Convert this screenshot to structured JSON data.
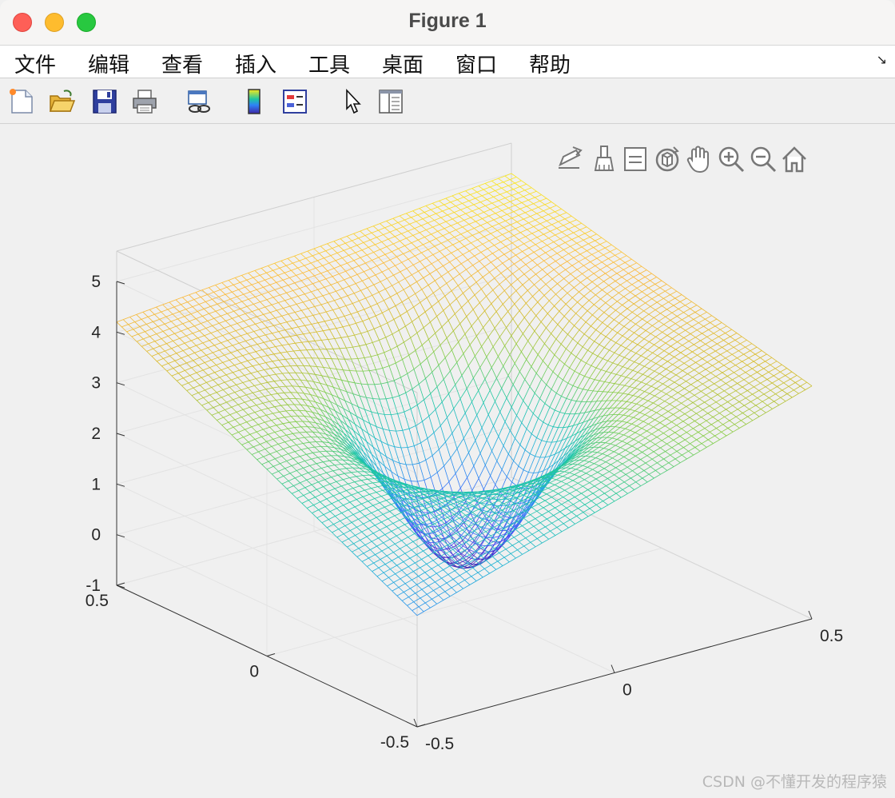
{
  "window": {
    "title": "Figure 1"
  },
  "menubar": {
    "items": [
      "文件",
      "编辑",
      "查看",
      "插入",
      "工具",
      "桌面",
      "窗口",
      "帮助"
    ],
    "corner_glyph": "↘"
  },
  "toolbar": {
    "buttons": [
      "new-figure-icon",
      "open-file-icon",
      "save-icon",
      "print-icon",
      "link-plot-icon",
      "insert-colorbar-icon",
      "insert-legend-icon",
      "edit-plot-arrow-icon",
      "property-inspector-icon"
    ]
  },
  "axes_toolbar": {
    "buttons": [
      "export-icon",
      "brush-icon",
      "datatip-icon",
      "rotate-3d-icon",
      "pan-hand-icon",
      "zoom-in-icon",
      "zoom-out-icon",
      "restore-view-home-icon"
    ]
  },
  "colors": {
    "colormap": [
      "#3e26a8",
      "#4743f3",
      "#2f82f6",
      "#1cb0d6",
      "#1ec7a3",
      "#7fcd49",
      "#d3bb2a",
      "#fbb839",
      "#f9e81b"
    ]
  },
  "chart_data": {
    "type": "surface",
    "style": "mesh",
    "colormap": "parula",
    "x": {
      "range": [
        -0.5,
        0.5
      ],
      "ticks": [
        -0.5,
        0,
        0.5
      ],
      "tick_labels": [
        "-0.5",
        "0",
        "0.5"
      ]
    },
    "y": {
      "range": [
        -0.5,
        0.5
      ],
      "ticks": [
        -0.5,
        0,
        0.5
      ],
      "tick_labels": [
        "-0.5",
        "0",
        "0.5"
      ]
    },
    "z": {
      "range": [
        -1,
        5
      ],
      "ticks": [
        -1,
        0,
        1,
        2,
        3,
        4,
        5
      ],
      "tick_labels": [
        "-1",
        "0",
        "1",
        "2",
        "3",
        "4",
        "5"
      ]
    },
    "grid": true,
    "title": "",
    "xlabel": "",
    "ylabel": "",
    "zlabel": "",
    "surface_values": {
      "corners": {
        "x-0.5_y-0.5": 1.2,
        "x0.5_y-0.5": 3.6,
        "x0.5_y0.5": 5.0,
        "x-0.5_y0.5": 4.2
      },
      "center_min": -0.3,
      "edge_midpoints": {
        "y-0.5": 1.4,
        "x0.5": 3.4,
        "y0.5": 4.3,
        "x-0.5": 3.0
      }
    }
  },
  "watermark": "CSDN @不懂开发的程序猿"
}
